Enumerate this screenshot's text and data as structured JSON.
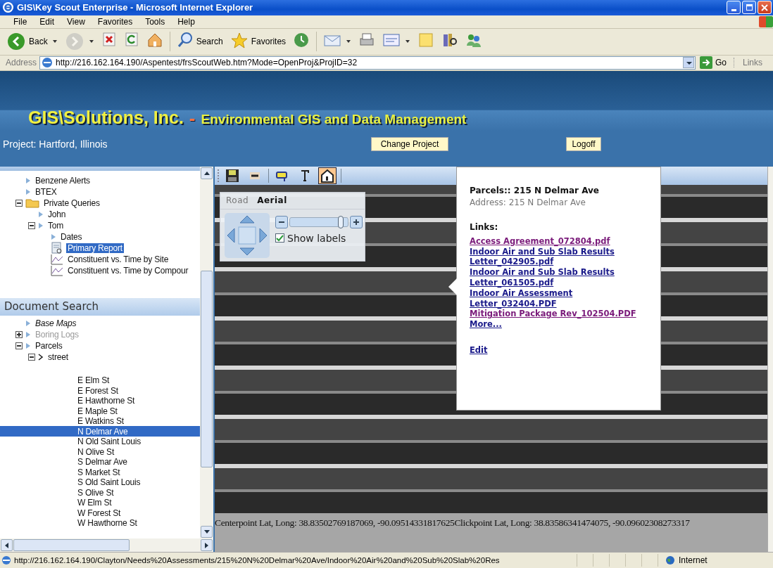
{
  "window": {
    "title": "GIS\\Key Scout Enterprise - Microsoft Internet Explorer"
  },
  "menu": [
    "File",
    "Edit",
    "View",
    "Favorites",
    "Tools",
    "Help"
  ],
  "toolbar": [
    {
      "kind": "back",
      "label": "Back",
      "dropdown": true,
      "disabled": false
    },
    {
      "kind": "forward",
      "dropdown": true,
      "disabled": true
    },
    {
      "kind": "stop",
      "disabled": false
    },
    {
      "kind": "refresh",
      "disabled": false
    },
    {
      "kind": "home",
      "disabled": false
    },
    {
      "kind": "search",
      "label": "Search",
      "disabled": false
    },
    {
      "kind": "favorites",
      "label": "Favorites",
      "disabled": false
    },
    {
      "kind": "history",
      "disabled": false
    },
    {
      "kind": "mail",
      "dropdown": true,
      "disabled": false
    },
    {
      "kind": "print",
      "disabled": false
    },
    {
      "kind": "edit",
      "dropdown": true,
      "disabled": false
    },
    {
      "kind": "note",
      "disabled": false
    },
    {
      "kind": "research",
      "disabled": false
    },
    {
      "kind": "messenger",
      "disabled": false
    }
  ],
  "address": {
    "label": "Address",
    "value": "http://216.162.164.190/Aspentest/frsScoutWeb.htm?Mode=OpenProj&ProjID=32",
    "go": "Go",
    "links": "Links"
  },
  "banner": {
    "title": "GIS\\Solutions, Inc.",
    "separator": "-",
    "subtitle": "Environmental GIS and Data Management"
  },
  "project": {
    "label": "Project: Hartford, Illinois",
    "buttons": [
      "Change Project",
      "Logoff"
    ]
  },
  "query_tree": [
    {
      "label": "Benzene Alerts",
      "kind": "query",
      "selected": false
    },
    {
      "label": "BTEX",
      "kind": "query",
      "selected": false
    },
    {
      "label": "Private Queries",
      "kind": "folder",
      "expanded": true,
      "selected": false,
      "children": [
        {
          "label": "John",
          "kind": "query",
          "selected": false
        },
        {
          "label": "Tom",
          "kind": "query",
          "expanded": true,
          "selected": false,
          "children": [
            {
              "label": "Dates",
              "kind": "query",
              "selected": false
            },
            {
              "label": "Primary Report",
              "kind": "report",
              "selected": true
            },
            {
              "label": "Constituent vs. Time by Site",
              "kind": "chart",
              "selected": false
            },
            {
              "label": "Constituent vs. Time by Compour",
              "kind": "chart",
              "selected": false
            }
          ]
        }
      ]
    }
  ],
  "document_search": {
    "title": "Document Search",
    "tree": [
      {
        "label": "Base Maps",
        "kind": "query",
        "emphasized": true,
        "selected": false
      },
      {
        "label": "Boring Logs",
        "kind": "query",
        "expanded": false,
        "disabled": true,
        "selected": false
      },
      {
        "label": "Parcels",
        "kind": "query",
        "expanded": true,
        "selected": false,
        "children": [
          {
            "label": "street",
            "kind": "field",
            "expanded": true,
            "selected": false,
            "children": [
              {
                "label": "E Elm St",
                "kind": "value",
                "selected": false
              },
              {
                "label": "E Forest St",
                "kind": "value",
                "selected": false
              },
              {
                "label": "E Hawthorne St",
                "kind": "value",
                "selected": false
              },
              {
                "label": "E Maple St",
                "kind": "value",
                "selected": false
              },
              {
                "label": "E Watkins St",
                "kind": "value",
                "selected": false
              },
              {
                "label": "N Delmar Ave",
                "kind": "value",
                "selected": true
              },
              {
                "label": "N Old Saint Louis",
                "kind": "value",
                "selected": false
              },
              {
                "label": "N Olive St",
                "kind": "value",
                "selected": false
              },
              {
                "label": "S Delmar Ave",
                "kind": "value",
                "selected": false
              },
              {
                "label": "S Market St",
                "kind": "value",
                "selected": false
              },
              {
                "label": "S Old Saint Louis",
                "kind": "value",
                "selected": false
              },
              {
                "label": "S Olive St",
                "kind": "value",
                "selected": false
              },
              {
                "label": "W Elm St",
                "kind": "value",
                "selected": false
              },
              {
                "label": "W Forest St",
                "kind": "value",
                "selected": false
              },
              {
                "label": "W Hawthorne St",
                "kind": "value",
                "selected": false
              }
            ]
          }
        ]
      }
    ]
  },
  "map": {
    "tools": [
      {
        "kind": "save",
        "selected": false
      },
      {
        "kind": "layers",
        "selected": false
      },
      {
        "kind": "label",
        "selected": false
      },
      {
        "kind": "text",
        "selected": false
      },
      {
        "kind": "house",
        "selected": true
      }
    ],
    "view_tabs": [
      {
        "label": "Road",
        "selected": false
      },
      {
        "label": "Aerial",
        "selected": true
      }
    ],
    "zoom": {
      "level": 0.88
    },
    "show_labels": {
      "label": "Show labels",
      "checked": true
    },
    "popup": {
      "title": "Parcels:: 215 N Delmar Ave",
      "address": "Address: 215 N Delmar Ave",
      "links_label": "Links:",
      "links": [
        {
          "text": "Access Agreement_072804.pdf",
          "visited": true
        },
        {
          "text": "Indoor Air and Sub Slab Results Letter_042905.pdf",
          "visited": false
        },
        {
          "text": "Indoor Air and Sub Slab Results Letter_061505.pdf",
          "visited": false
        },
        {
          "text": "Indoor Air Assessment Letter_032404.PDF",
          "visited": false
        },
        {
          "text": "Mitigation Package Rev_102504.PDF",
          "visited": true
        },
        {
          "text": "More...",
          "visited": false
        }
      ],
      "edit": "Edit"
    },
    "coordinates": "Centerpoint Lat, Long: 38.83502769187069, -90.09514331817625Clickpoint Lat, Long: 38.83586341474075, -90.09602308273317"
  },
  "status_bar": {
    "url": "http://216.162.164.190/Clayton/Needs%20Assessments/215%20N%20Delmar%20Ave/Indoor%20Air%20and%20Sub%20Slab%20Res",
    "zone": "Internet"
  }
}
